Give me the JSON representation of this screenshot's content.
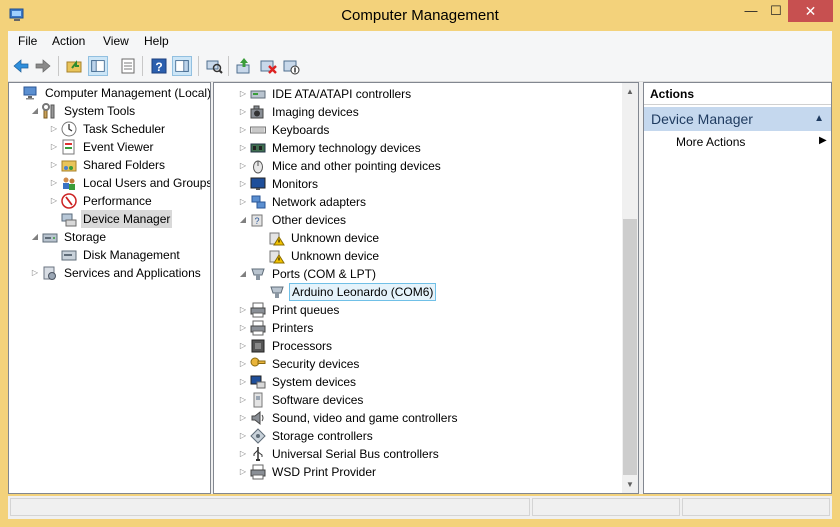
{
  "window": {
    "title": "Computer Management",
    "minimize": "—",
    "maximize": "☐",
    "close": "✕"
  },
  "menu": [
    "File",
    "Action",
    "View",
    "Help"
  ],
  "toolbar": {
    "icons": [
      "back-icon",
      "forward-icon",
      "up-folder-icon",
      "show-hide-tree-icon",
      "properties-icon",
      "help-icon",
      "show-hide-action-pane-icon",
      "scan-hardware-icon",
      "update-driver-icon",
      "uninstall-icon",
      "disable-device-icon"
    ]
  },
  "left_tree": [
    {
      "label": "Computer Management (Local)",
      "expander": "",
      "icon": "computer-management-icon",
      "depth": 0
    },
    {
      "label": "System Tools",
      "expander": "◢",
      "icon": "tools-icon",
      "depth": 1
    },
    {
      "label": "Task Scheduler",
      "expander": "▷",
      "icon": "clock-icon",
      "depth": 2
    },
    {
      "label": "Event Viewer",
      "expander": "▷",
      "icon": "event-viewer-icon",
      "depth": 2
    },
    {
      "label": "Shared Folders",
      "expander": "▷",
      "icon": "shared-folder-icon",
      "depth": 2
    },
    {
      "label": "Local Users and Groups",
      "expander": "▷",
      "icon": "users-icon",
      "depth": 2
    },
    {
      "label": "Performance",
      "expander": "▷",
      "icon": "performance-icon",
      "depth": 2
    },
    {
      "label": "Device Manager",
      "expander": "",
      "icon": "device-manager-icon",
      "depth": 2,
      "selected": true
    },
    {
      "label": "Storage",
      "expander": "◢",
      "icon": "storage-icon",
      "depth": 1
    },
    {
      "label": "Disk Management",
      "expander": "",
      "icon": "disk-icon",
      "depth": 2
    },
    {
      "label": "Services and Applications",
      "expander": "▷",
      "icon": "services-icon",
      "depth": 1
    }
  ],
  "device_tree": [
    {
      "label": "IDE ATA/ATAPI controllers",
      "expander": "▷",
      "icon": "ide-controller-icon",
      "depth": 0
    },
    {
      "label": "Imaging devices",
      "expander": "▷",
      "icon": "camera-icon",
      "depth": 0
    },
    {
      "label": "Keyboards",
      "expander": "▷",
      "icon": "keyboard-icon",
      "depth": 0
    },
    {
      "label": "Memory technology devices",
      "expander": "▷",
      "icon": "memory-icon",
      "depth": 0
    },
    {
      "label": "Mice and other pointing devices",
      "expander": "▷",
      "icon": "mouse-icon",
      "depth": 0
    },
    {
      "label": "Monitors",
      "expander": "▷",
      "icon": "monitor-icon",
      "depth": 0
    },
    {
      "label": "Network adapters",
      "expander": "▷",
      "icon": "network-icon",
      "depth": 0
    },
    {
      "label": "Other devices",
      "expander": "◢",
      "icon": "other-devices-icon",
      "depth": 0
    },
    {
      "label": "Unknown device",
      "expander": "",
      "icon": "warning-device-icon",
      "depth": 1
    },
    {
      "label": "Unknown device",
      "expander": "",
      "icon": "warning-device-icon",
      "depth": 1
    },
    {
      "label": "Ports (COM & LPT)",
      "expander": "◢",
      "icon": "port-icon",
      "depth": 0
    },
    {
      "label": "Arduino Leonardo (COM6)",
      "expander": "",
      "icon": "port-icon",
      "depth": 1,
      "selected": true
    },
    {
      "label": "Print queues",
      "expander": "▷",
      "icon": "printer-icon",
      "depth": 0
    },
    {
      "label": "Printers",
      "expander": "▷",
      "icon": "printer-icon",
      "depth": 0
    },
    {
      "label": "Processors",
      "expander": "▷",
      "icon": "processor-icon",
      "depth": 0
    },
    {
      "label": "Security devices",
      "expander": "▷",
      "icon": "security-key-icon",
      "depth": 0
    },
    {
      "label": "System devices",
      "expander": "▷",
      "icon": "system-devices-icon",
      "depth": 0
    },
    {
      "label": "Software devices",
      "expander": "▷",
      "icon": "software-device-icon",
      "depth": 0
    },
    {
      "label": "Sound, video and game controllers",
      "expander": "▷",
      "icon": "speaker-icon",
      "depth": 0
    },
    {
      "label": "Storage controllers",
      "expander": "▷",
      "icon": "storage-controller-icon",
      "depth": 0
    },
    {
      "label": "Universal Serial Bus controllers",
      "expander": "▷",
      "icon": "usb-icon",
      "depth": 0
    },
    {
      "label": "WSD Print Provider",
      "expander": "▷",
      "icon": "printer-icon",
      "depth": 0
    }
  ],
  "actions": {
    "header": "Actions",
    "group": "Device Manager",
    "group_arrow": "▲",
    "item": "More Actions",
    "item_arrow": "▶"
  },
  "scrollbar": {
    "up": "▲",
    "down": "▼"
  },
  "colors": {
    "frame": "#f3d27b",
    "selection_blue": "#e5f3fb",
    "selection_border": "#70c0e7",
    "actions_group": "#c5d8ee",
    "close_button": "#c75050"
  }
}
